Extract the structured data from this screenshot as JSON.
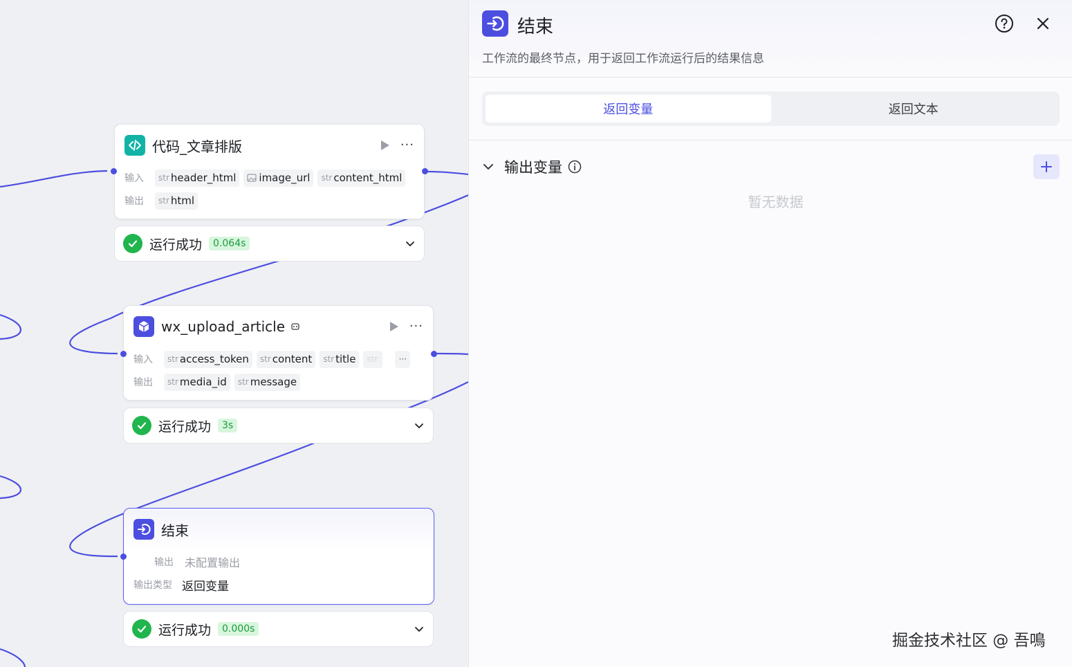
{
  "nodes": {
    "code": {
      "title": "代码_文章排版",
      "input_label": "输入",
      "output_label": "输出",
      "inputs": [
        {
          "type": "str",
          "name": "header_html"
        },
        {
          "type": "image",
          "name": "image_url"
        },
        {
          "type": "str",
          "name": "content_html"
        }
      ],
      "outputs": [
        {
          "type": "str",
          "name": "html"
        }
      ],
      "status": "运行成功",
      "time": "0.064s"
    },
    "upload": {
      "title": "wx_upload_article",
      "input_label": "输入",
      "output_label": "输出",
      "inputs": [
        {
          "type": "str",
          "name": "access_token"
        },
        {
          "type": "str",
          "name": "content"
        },
        {
          "type": "str",
          "name": "title"
        },
        {
          "type": "str",
          "name": ""
        }
      ],
      "more": "···",
      "outputs": [
        {
          "type": "str",
          "name": "media_id"
        },
        {
          "type": "str",
          "name": "message"
        }
      ],
      "status": "运行成功",
      "time": "3s"
    },
    "end": {
      "title": "结束",
      "output_label": "输出",
      "output_value": "未配置输出",
      "type_label": "输出类型",
      "type_value": "返回变量",
      "status": "运行成功",
      "time": "0.000s"
    }
  },
  "panel": {
    "title": "结束",
    "description": "工作流的最终节点，用于返回工作流运行后的结果信息",
    "tabs": [
      {
        "label": "返回变量",
        "active": true
      },
      {
        "label": "返回文本",
        "active": false
      }
    ],
    "section_title": "输出变量",
    "empty_text": "暂无数据"
  },
  "watermark": "掘金技术社区 @ 吾鳴",
  "colors": {
    "accent": "#4c4ee0",
    "success": "#20b54d",
    "code_icon": "#11b3a6"
  }
}
